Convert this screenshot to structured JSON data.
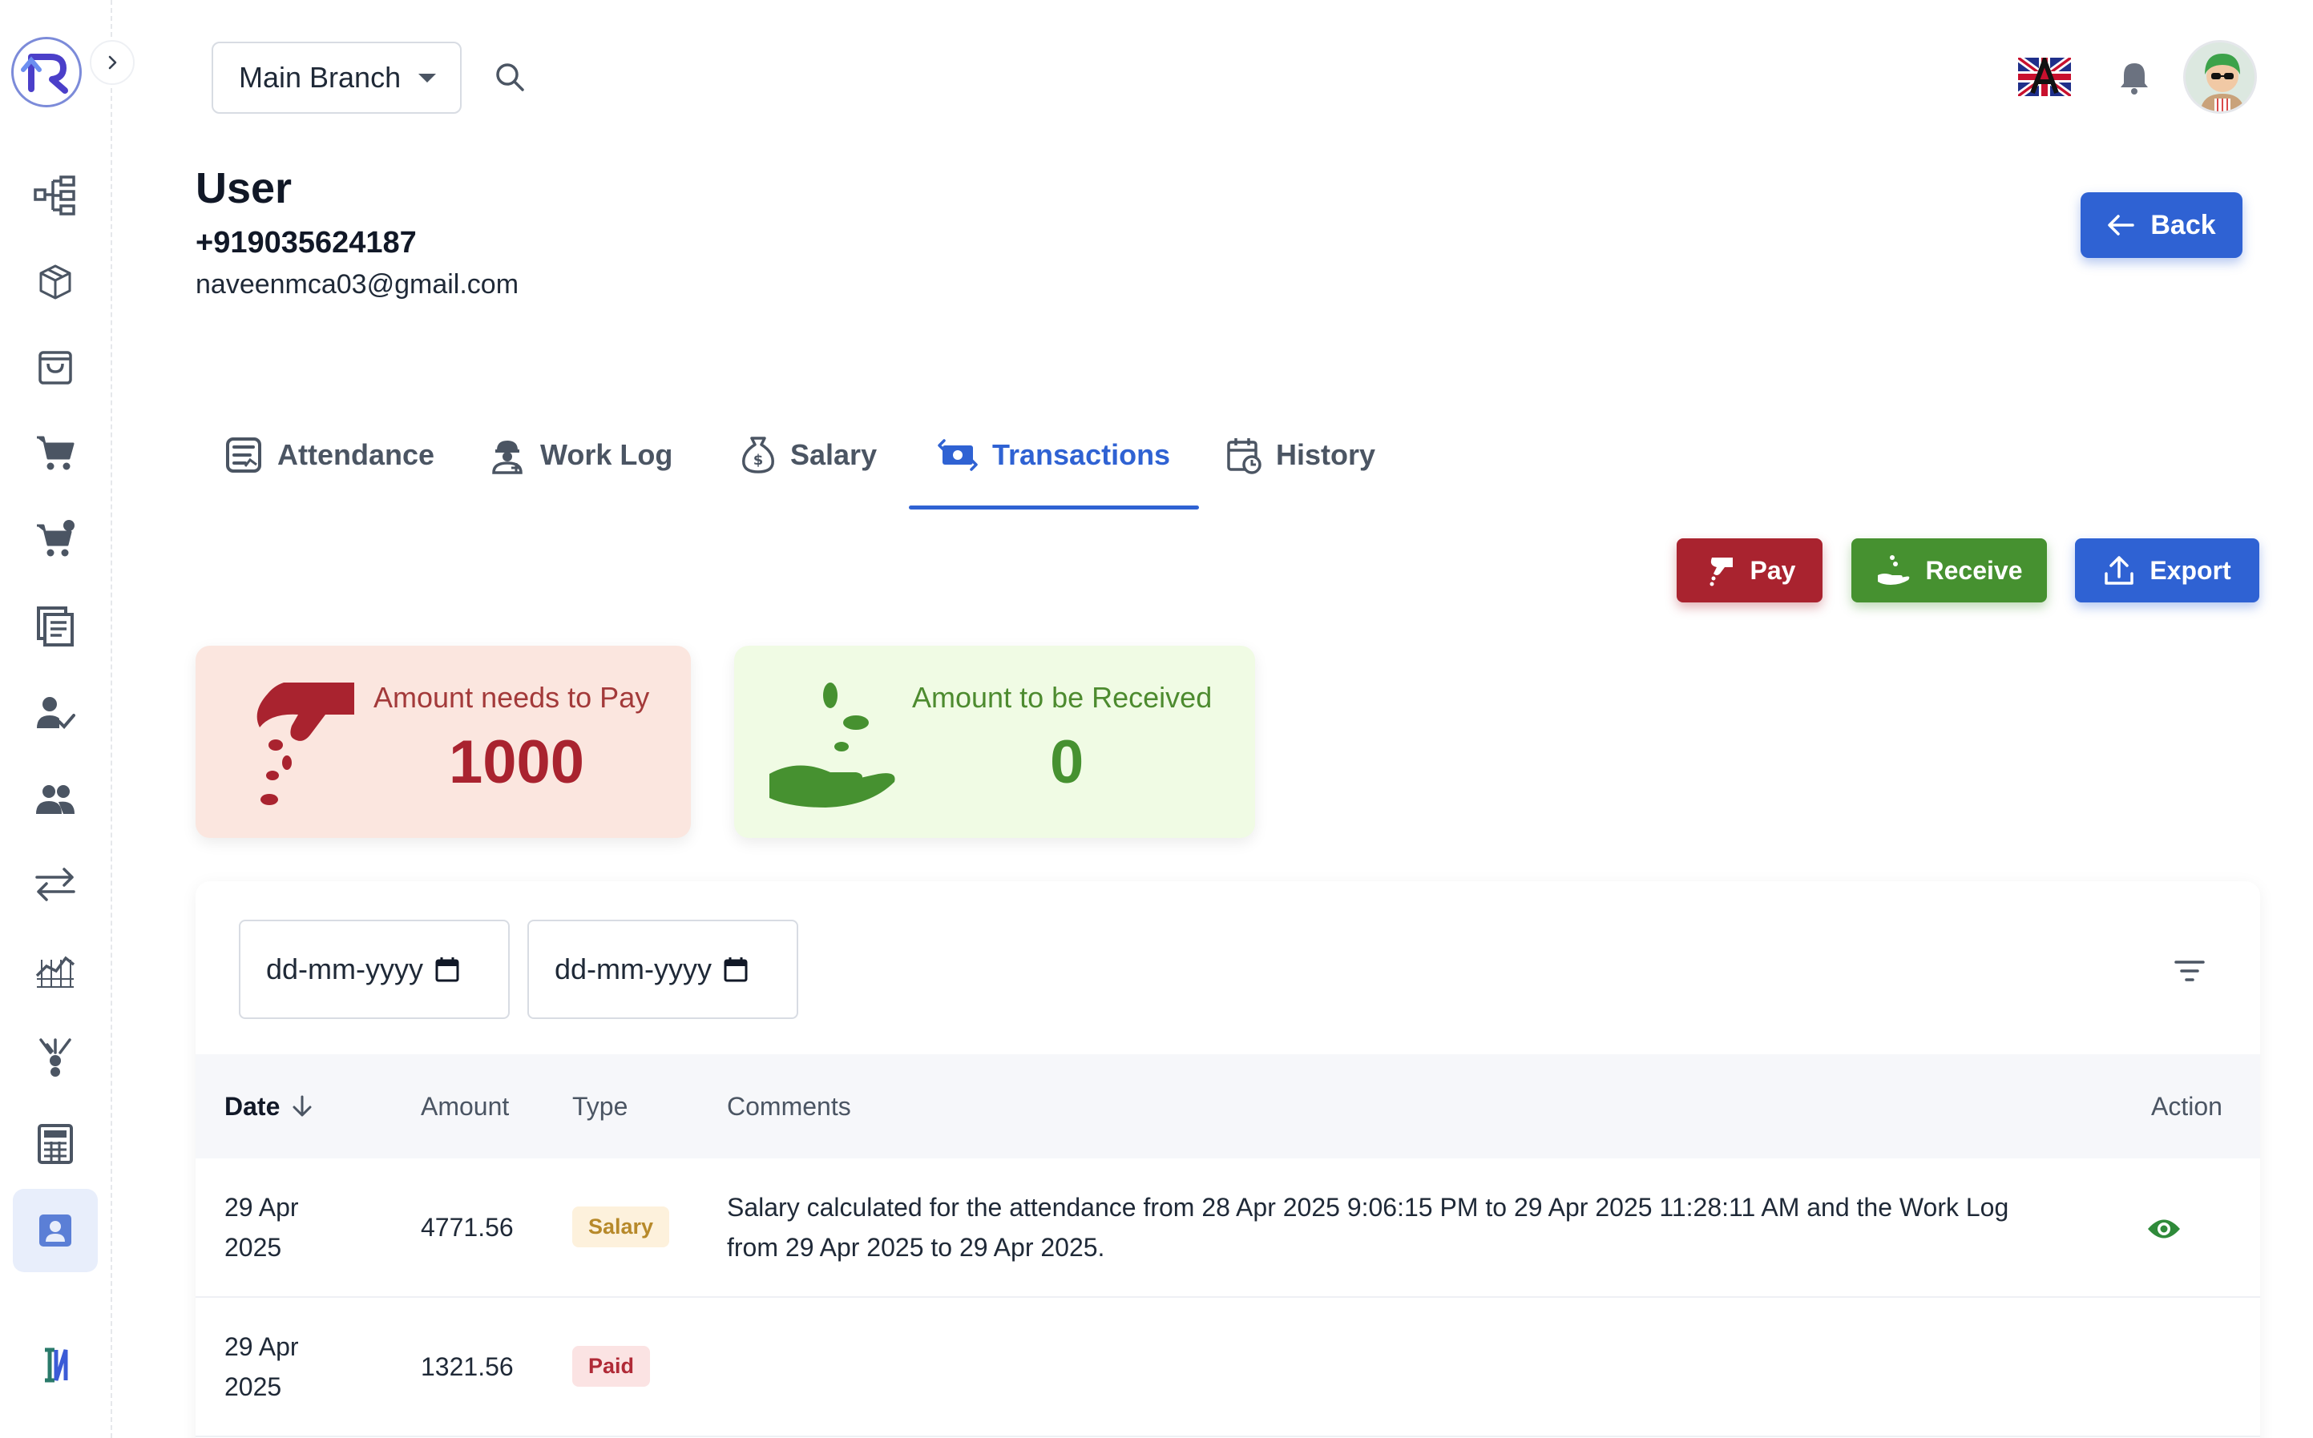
{
  "header": {
    "branch": "Main Branch"
  },
  "user": {
    "title": "User",
    "phone": "+919035624187",
    "email": "naveenmca03@gmail.com",
    "back_label": "Back"
  },
  "tabs": [
    {
      "label": "Attendance",
      "icon": "attendance-icon"
    },
    {
      "label": "Work Log",
      "icon": "worker-icon"
    },
    {
      "label": "Salary",
      "icon": "money-bag-icon"
    },
    {
      "label": "Transactions",
      "icon": "money-transfer-icon",
      "active": true
    },
    {
      "label": "History",
      "icon": "calendar-history-icon"
    }
  ],
  "actions": {
    "pay": "Pay",
    "receive": "Receive",
    "export": "Export"
  },
  "summary": {
    "pay_label": "Amount needs to Pay",
    "pay_value": "1000",
    "receive_label": "Amount to be Received",
    "receive_value": "0"
  },
  "filters": {
    "from_placeholder": "dd-mm-yyyy",
    "to_placeholder": "dd-mm-yyyy"
  },
  "table": {
    "columns": {
      "date": "Date",
      "amount": "Amount",
      "type": "Type",
      "comments": "Comments",
      "action": "Action"
    },
    "rows": [
      {
        "date_line1": "29 Apr",
        "date_line2": "2025",
        "amount": "4771.56",
        "type": "Salary",
        "comment": "Salary calculated for the attendance from 28 Apr 2025 9:06:15 PM to 29 Apr 2025 11:28:11 AM and the Work Log from 29 Apr 2025 to 29 Apr 2025."
      },
      {
        "date_line1": "29 Apr",
        "date_line2": "2025",
        "amount": "1321.56",
        "type": "Paid",
        "comment": ""
      }
    ]
  },
  "colors": {
    "primary": "#2f62d3",
    "pay": "#a9232f",
    "receive": "#469130"
  }
}
